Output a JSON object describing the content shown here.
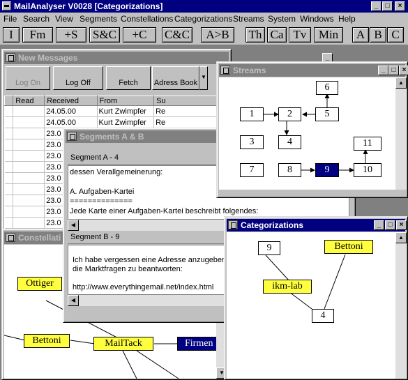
{
  "app": {
    "title": "MailAnalyser V0028 [Categorizations]"
  },
  "menu": [
    "File",
    "Search",
    "View",
    "Segments",
    "Constellations",
    "Categorizations",
    "Streams",
    "System",
    "Windows",
    "Help"
  ],
  "toolbar": [
    "I",
    "Fm",
    "+S",
    "S&C",
    "+C",
    "C&C",
    "A>B",
    "Th",
    "Ca",
    "Tv",
    "Min",
    "A",
    "B",
    "C"
  ],
  "new_messages": {
    "title": "New Messages",
    "buttons": [
      "Log On",
      "Log Off",
      "Fetch",
      "Adress Book"
    ],
    "columns": [
      "Read",
      "Received",
      "From",
      "Su"
    ],
    "rows": [
      [
        "",
        "24.05.00",
        "Kurt Zwimpfer",
        "Re"
      ],
      [
        "",
        "24.05.00",
        "Kurt Zwimpfer",
        "Re"
      ],
      [
        "",
        "23.0",
        "",
        ""
      ],
      [
        "",
        "23.0",
        "",
        ""
      ],
      [
        "",
        "23.0",
        "",
        ""
      ],
      [
        "",
        "23.0",
        "",
        ""
      ],
      [
        "",
        "23.0",
        "",
        ""
      ],
      [
        "",
        "23.0",
        "",
        ""
      ],
      [
        "",
        "23.0",
        "",
        ""
      ],
      [
        "",
        "23.0",
        "",
        ""
      ],
      [
        "",
        "23.0",
        "",
        ""
      ]
    ]
  },
  "segments": {
    "title": "Segments A & B",
    "a_label": "Segment A - 4",
    "a_lines": [
      "dessen Verallgemeinerung:",
      "",
      "A. Aufgaben-Kartei",
      "==============",
      "Jede Karte einer Aufgaben-Kartei beschreibt folgendes:"
    ],
    "b_label": "Segment B - 9",
    "b_lines": [
      "Ich habe vergessen eine Adresse anzugeben,",
      "die Marktfragen zu beantworten:",
      "",
      "http://www.everythingemail.net/index.html"
    ]
  },
  "constellations": {
    "title": "Constellati",
    "nodes": [
      "Ottiger",
      "Bettoni",
      "MailTack",
      "Firmen"
    ]
  },
  "streams": {
    "title": "Streams",
    "nodes": [
      "1",
      "2",
      "3",
      "4",
      "5",
      "6",
      "7",
      "8",
      "9",
      "10",
      "11"
    ]
  },
  "categorizations": {
    "title": "Categorizations",
    "nodes": [
      "9",
      "Bettoni",
      "ikm-lab",
      "4"
    ]
  },
  "colors": {
    "title_active": "#000080",
    "title_inactive": "#808080",
    "node_yellow": "#ffff40",
    "face": "#c0c0c0"
  }
}
